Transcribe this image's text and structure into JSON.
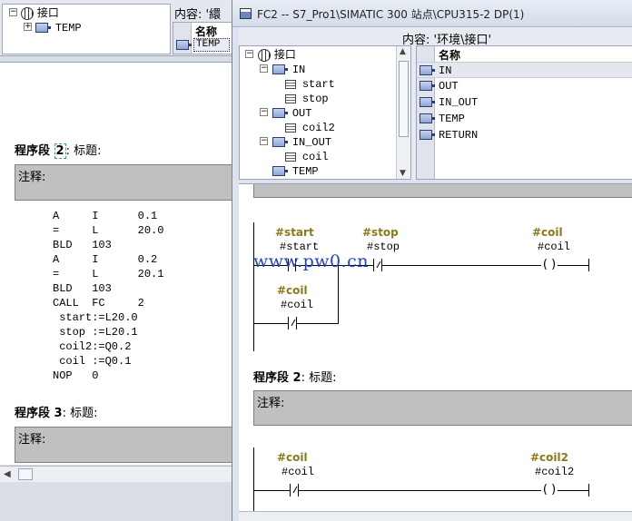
{
  "back_window": {
    "content_label": "内容: '繯",
    "tree": [
      {
        "label": "接口",
        "expander": "−"
      },
      {
        "label": "TEMP",
        "expander": "+"
      }
    ],
    "list_header": "名称",
    "list_items": [
      "TEMP"
    ],
    "networks": [
      {
        "title_prefix": "程序段 ",
        "number": "2",
        "title_suffix": ": 标题:",
        "comment": "注释:",
        "stl": "A     I      0.1\n=     L      20.0\nBLD   103\nA     I      0.2\n=     L      20.1\nBLD   103\nCALL  FC     2\n start:=L20.0\n stop :=L20.1\n coil2:=Q0.2\n coil :=Q0.1\nNOP   0"
      },
      {
        "title_prefix": "程序段 ",
        "number": "3",
        "title_suffix": ": 标题:",
        "comment": "注释:"
      }
    ]
  },
  "front_window": {
    "title": "FC2 -- S7_Pro1\\SIMATIC 300 站点\\CPU315-2 DP(1)",
    "content_label": "内容: '环境\\接口'",
    "tree": [
      {
        "label": "接口",
        "level": 0,
        "expander": "−",
        "icon": "globe-icon"
      },
      {
        "label": "IN",
        "level": 1,
        "expander": "−",
        "icon": "param-icon"
      },
      {
        "label": "start",
        "level": 2,
        "expander": "",
        "icon": "variable-icon"
      },
      {
        "label": "stop",
        "level": 2,
        "expander": "",
        "icon": "variable-icon"
      },
      {
        "label": "OUT",
        "level": 1,
        "expander": "−",
        "icon": "param-icon"
      },
      {
        "label": "coil2",
        "level": 2,
        "expander": "",
        "icon": "variable-icon"
      },
      {
        "label": "IN_OUT",
        "level": 1,
        "expander": "−",
        "icon": "param-icon"
      },
      {
        "label": "coil",
        "level": 2,
        "expander": "",
        "icon": "variable-icon"
      },
      {
        "label": "TEMP",
        "level": 1,
        "expander": "",
        "icon": "param-icon"
      }
    ],
    "list_header": "名称",
    "list_items": [
      "IN",
      "OUT",
      "IN_OUT",
      "TEMP",
      "RETURN"
    ],
    "network1": {
      "contact1_symbol": "#start",
      "contact1_address": "#start",
      "contact2_symbol": "#stop",
      "contact2_address": "#stop",
      "coil_symbol": "#coil",
      "coil_address": "#coil",
      "branch_symbol": "#coil",
      "branch_address": "#coil",
      "watermark": "www.pw0.cn"
    },
    "network2": {
      "title_prefix": "程序段 ",
      "number": "2",
      "title_suffix": ": 标题:",
      "comment": "注释:",
      "contact_symbol": "#coil",
      "contact_address": "#coil",
      "coil_symbol": "#coil2",
      "coil_address": "#coil2"
    }
  }
}
